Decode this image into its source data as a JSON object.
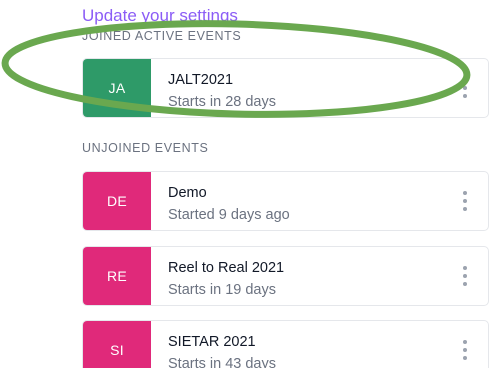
{
  "header": {
    "settings_link": "Update your settings"
  },
  "joined": {
    "heading": "JOINED ACTIVE EVENTS",
    "events": [
      {
        "initials": "JA",
        "name": "JALT2021",
        "status": "Starts in 28 days",
        "color": "#2e9a68"
      }
    ]
  },
  "unjoined": {
    "heading": "UNJOINED EVENTS",
    "events": [
      {
        "initials": "DE",
        "name": "Demo",
        "status": "Started 9 days ago",
        "color": "#e0297a"
      },
      {
        "initials": "RE",
        "name": "Reel to Real 2021",
        "status": "Starts in 19 days",
        "color": "#e0297a"
      },
      {
        "initials": "SI",
        "name": "SIETAR 2021",
        "status": "Starts in 43 days",
        "color": "#e0297a"
      }
    ]
  },
  "annotation": {
    "ring_color": "#6aa84f"
  }
}
